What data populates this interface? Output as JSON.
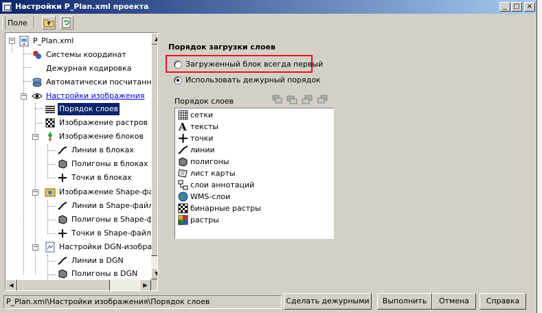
{
  "window": {
    "title": "Настройки P_Plan.xml проекта",
    "min_glyph": "_",
    "max_glyph": "□",
    "close_glyph": "×"
  },
  "toolbar": {
    "field_label": "Поле"
  },
  "tree": {
    "items": [
      {
        "label": "P_Plan.xml",
        "icon": "xml-file-icon"
      },
      {
        "label": "Системы координат",
        "icon": "coordinate-systems-icon"
      },
      {
        "label": "Дежурная кодировка",
        "icon": ""
      },
      {
        "label": "Автоматически посчитанное",
        "icon": "auto-calc-icon"
      },
      {
        "label": "Настройки изображения",
        "icon": "eye-icon"
      },
      {
        "label": "Порядок слоев",
        "icon": "layers-stack-icon"
      },
      {
        "label": "Изображение растров",
        "icon": "raster-icon"
      },
      {
        "label": "Изображение блоков",
        "icon": "blocks-icon"
      },
      {
        "label": "Линии в блоках",
        "icon": "line-icon"
      },
      {
        "label": "Полигоны в блоках",
        "icon": "polygon-icon"
      },
      {
        "label": "Точки в блоках",
        "icon": "point-icon"
      },
      {
        "label": "Изображение Shape-файл",
        "icon": "shape-file-icon"
      },
      {
        "label": "Линии в Shape-файла",
        "icon": "line-icon"
      },
      {
        "label": "Полигоны в Shape-фа",
        "icon": "polygon-icon"
      },
      {
        "label": "Точки в Shape-файла",
        "icon": "point-icon"
      },
      {
        "label": "Настройки DGN-изображ",
        "icon": "dgn-icon"
      },
      {
        "label": "Линии в DGN",
        "icon": "line-icon"
      },
      {
        "label": "Полигоны в DGN",
        "icon": "polygon-icon"
      }
    ]
  },
  "panel": {
    "section_title": "Порядок загрузки слоев",
    "radio_first": "Загруженный блок всегда первый",
    "radio_default": "Использовать дежурный порядок",
    "layers_label": "Порядок слоев",
    "selected_radio": "radio_default"
  },
  "layers": [
    {
      "label": "сетки",
      "icon": "grid-icon"
    },
    {
      "label": "тексты",
      "icon": "text-icon"
    },
    {
      "label": "точки",
      "icon": "point-icon"
    },
    {
      "label": "линии",
      "icon": "line-icon"
    },
    {
      "label": "полигоны",
      "icon": "polygon-icon"
    },
    {
      "label": "лист карты",
      "icon": "map-sheet-icon"
    },
    {
      "label": "слои аннотаций",
      "icon": "annotation-icon"
    },
    {
      "label": "WMS-слои",
      "icon": "globe-icon"
    },
    {
      "label": "бинарные растры",
      "icon": "binary-raster-icon"
    },
    {
      "label": "растры",
      "icon": "raster-color-icon"
    }
  ],
  "status": {
    "path": "P_Plan.xml\\Настройки изображения\\Порядок слоев"
  },
  "buttons": {
    "make_default": "Сделать дежурными",
    "execute": "Выполнить",
    "cancel": "Отмена",
    "help": "Справка"
  },
  "colors": {
    "selection": "#0a246a",
    "highlight_box": "#e8141e",
    "link": "#0000cc"
  }
}
